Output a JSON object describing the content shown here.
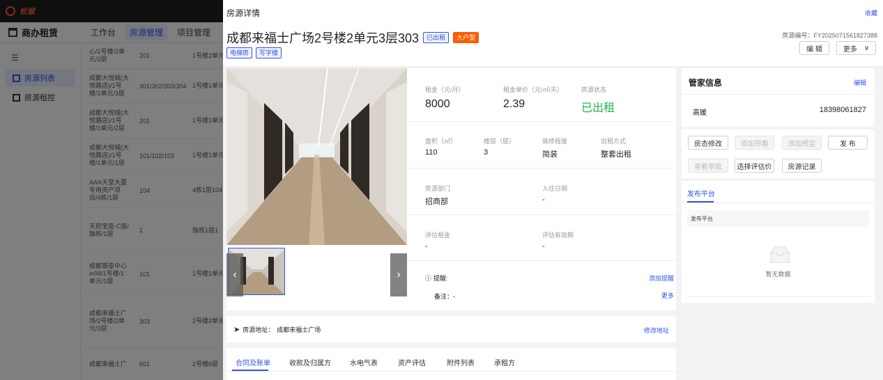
{
  "background": {
    "logo_text": "松鼠",
    "brand": "商办租赁",
    "nav": [
      "工作台",
      "房源管理",
      "项目管理"
    ],
    "sidebar_items": [
      "房源列表",
      "房源租控"
    ],
    "rows": [
      {
        "name": "心/1号楼/2单元/2层",
        "room": "201",
        "loc": "1号楼2单元 201"
      },
      {
        "name": "成都大悦城(大悦路店)/1号楼/1单元/3层",
        "room": "301/302/303/304",
        "loc": "1号楼1单元 301/302/30"
      },
      {
        "name": "成都大悦城(大悦路店)/1号楼/1单元/2层",
        "room": "201",
        "loc": "1号楼1单元 201"
      },
      {
        "name": "成都大悦城(大悦路店)/1号楼/1单元/1层",
        "room": "101/102/103",
        "loc": "1号楼1单元 101/102/10"
      },
      {
        "name": "AAA天堂大厦专用资产项目/4栋/1层",
        "room": "104",
        "loc": "4栋1层104"
      },
      {
        "name": "天府宝座-C座/独栋/1层",
        "room": "1",
        "loc": "独栋1层1"
      },
      {
        "name": "成都银泰中心 in99/1号楼/1单元/1层",
        "room": "101",
        "loc": "1号楼1单元 101"
      },
      {
        "name": "成都来福士广场/2号楼/2单元/3层",
        "room": "303",
        "loc": "2号楼2单元 303"
      },
      {
        "name": "成都来福士广",
        "room": "601",
        "loc": "2号楼6层"
      }
    ]
  },
  "drawer": {
    "title_small": "房源详情",
    "favorite": "收藏",
    "title": "成都来福士广场2号楼2单元3层303",
    "status_tag": "已出租",
    "size_tag": "大户型",
    "tags": [
      "电梯房",
      "写字楼"
    ],
    "code_label": "房源编号：",
    "code_value": "FY2025071561827388",
    "edit_btn": "编 辑",
    "more_btn": "更多",
    "stats": {
      "rent_label": "租金（元/月）",
      "rent": "8000",
      "unit_label": "租金单价（元/㎡/天）",
      "unit": "2.39",
      "status_label": "房源状态",
      "status": "已出租",
      "area_label": "面积（㎡）",
      "area": "110",
      "floor_label": "楼层（层）",
      "floor": "3",
      "decor_label": "装修程度",
      "decor": "简装",
      "mode_label": "出租方式",
      "mode": "整套出租",
      "dept_label": "房源部门",
      "dept": "招商部",
      "checkin_label": "入住日期",
      "checkin": "-",
      "eval_label": "评估租金",
      "eval": "-",
      "evalperiod_label": "评估有效期",
      "evalperiod": "-"
    },
    "reminder_label": "提醒:",
    "add_reminder": "添加提醒",
    "remark_label": "备注：-",
    "more_link": "更多",
    "address_label": "房源地址：",
    "address": "成都来福士广场",
    "edit_address": "修改地址",
    "tabs": [
      "合同及账单",
      "收款及归属方",
      "水电气表",
      "资产评估",
      "附件列表",
      "承租方"
    ]
  },
  "steward": {
    "title": "管家信息",
    "edit": "编辑",
    "name": "高媛",
    "phone": "18398061827"
  },
  "actions": {
    "row1": [
      "房态修改",
      "添加带看",
      "添加预定",
      "发 布"
    ],
    "row2": [
      "查看审批",
      "选择评估价",
      "房源记录"
    ]
  },
  "platform": {
    "tab": "发布平台",
    "header": "发布平台",
    "empty": "暂无数据"
  },
  "colors": {
    "accent": "#2f54eb",
    "status_green": "#22b14c",
    "tag_orange": "#ff5a00"
  }
}
